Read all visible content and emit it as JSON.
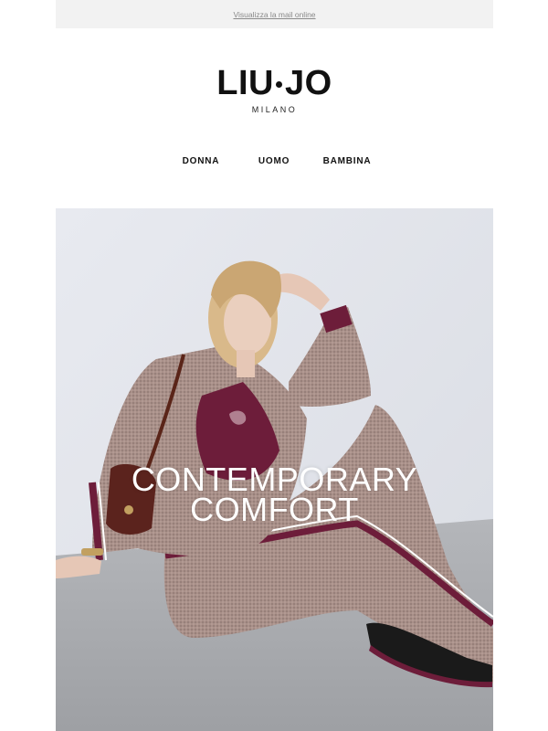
{
  "preheader": {
    "view_online_label": "Visualizza la mail online"
  },
  "brand": {
    "logo_left": "LIU",
    "logo_right": "JO",
    "logo_sub": "MILANO"
  },
  "nav": {
    "items": [
      "DONNA",
      "UOMO",
      "BAMBINA"
    ]
  },
  "hero": {
    "headline_line1": "CONTEMPORARY",
    "headline_line2": "COMFORT",
    "image_description": "model in houndstooth tracksuit with burgundy stripes, burgundy top and shoulder bag, seated on grey floor"
  },
  "colors": {
    "burgundy": "#6d1d3a",
    "fabric": "#a88e86",
    "wall": "#e4e6ec",
    "floor": "#a9abaf"
  }
}
